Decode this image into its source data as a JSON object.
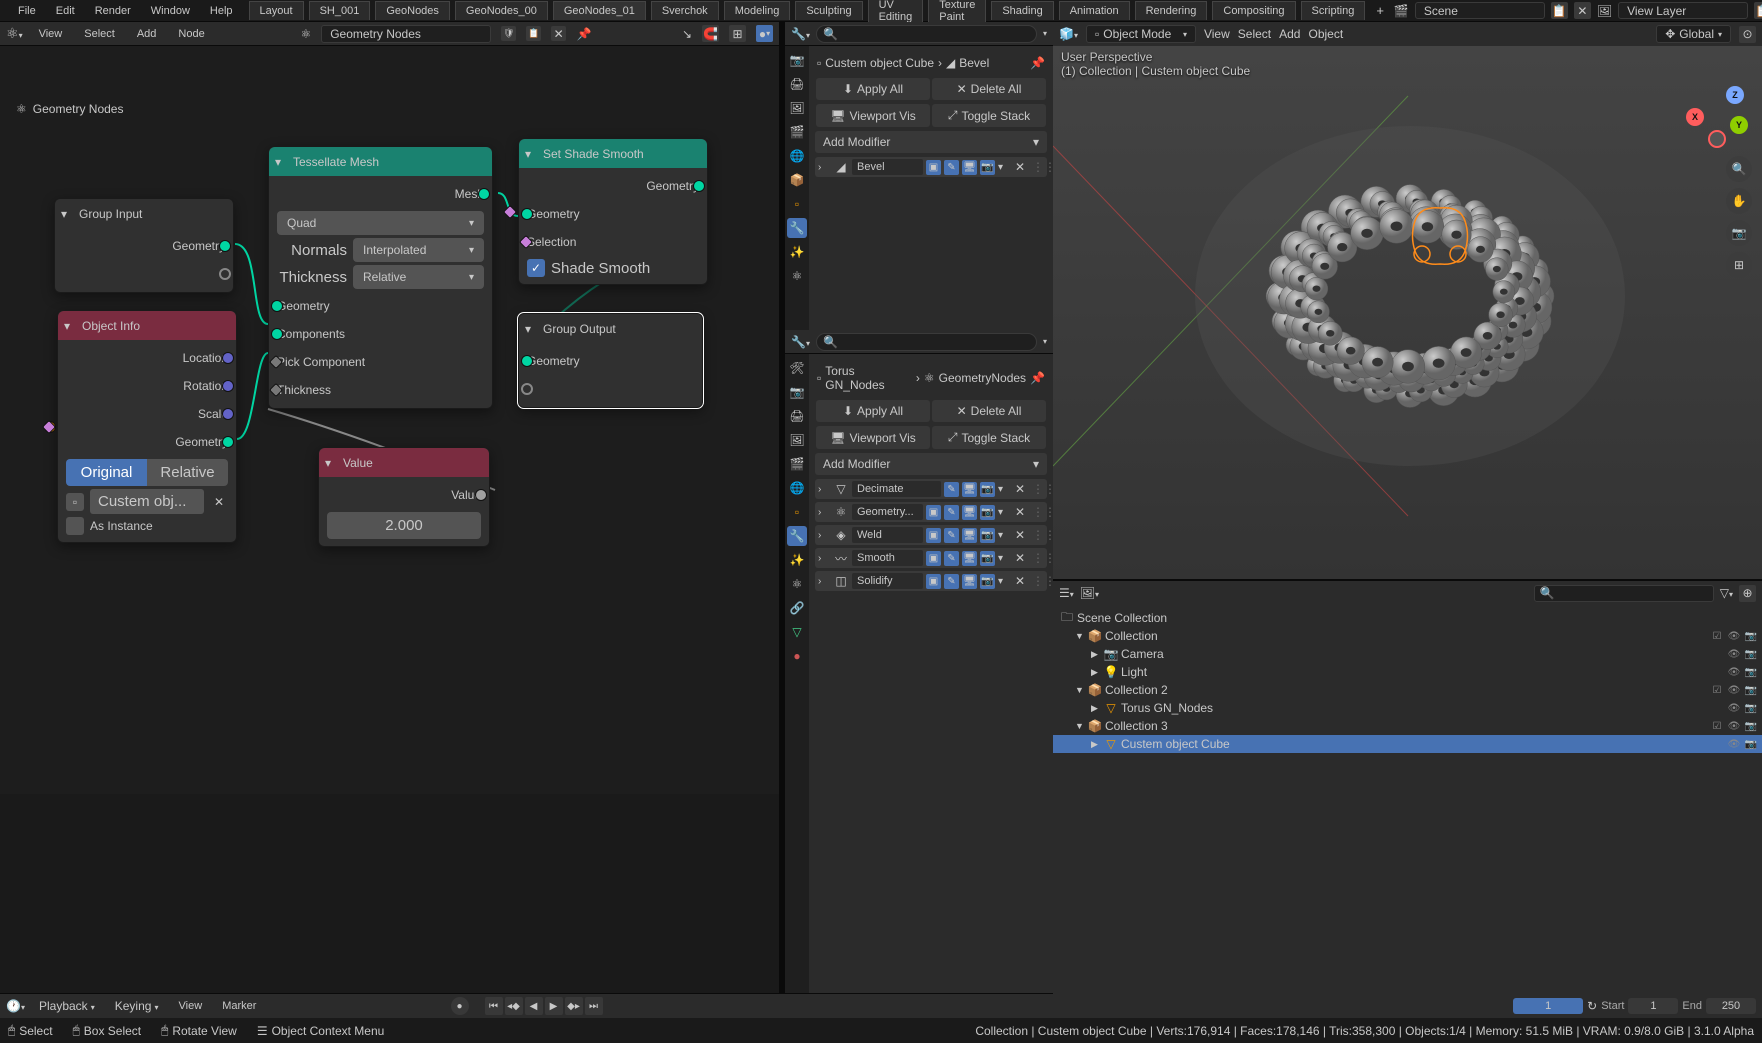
{
  "menubar": {
    "menus": [
      "File",
      "Edit",
      "Render",
      "Window",
      "Help"
    ],
    "workspaces": [
      "Layout",
      "SH_001",
      "GeoNodes",
      "GeoNodes_00",
      "GeoNodes_01",
      "Sverchok",
      "Modeling",
      "Sculpting",
      "UV Editing",
      "Texture Paint",
      "Shading",
      "Animation",
      "Rendering",
      "Compositing",
      "Scripting"
    ],
    "active_workspace": "GeoNodes_01",
    "scene_label": "Scene",
    "viewlayer_label": "View Layer"
  },
  "node_editor": {
    "header_menus": [
      "View",
      "Select",
      "Add",
      "Node"
    ],
    "datablock": "Geometry Nodes",
    "breadcrumb_icon": "node-tree",
    "breadcrumb": "Geometry Nodes"
  },
  "view3d": {
    "mode": "Object Mode",
    "menus": [
      "View",
      "Select",
      "Add",
      "Object"
    ],
    "orientation": "Global",
    "overlay_line1": "User Perspective",
    "overlay_line2": "(1) Collection | Custem object Cube"
  },
  "nodes": {
    "group_input": {
      "title": "Group Input",
      "outputs": [
        "Geometry"
      ]
    },
    "object_info": {
      "title": "Object Info",
      "outputs": [
        "Location",
        "Rotation",
        "Scale",
        "Geometry"
      ],
      "mode_options": [
        "Original",
        "Relative"
      ],
      "mode_active": "Original",
      "object_ref": "Custem obj...",
      "as_instance": "As Instance"
    },
    "tessellate": {
      "title": "Tessellate Mesh",
      "out_mesh": "Mesh",
      "mode": "Quad",
      "normals_label": "Normals",
      "normals_value": "Interpolated",
      "thickness_label": "Thickness",
      "thickness_value": "Relative",
      "in_geometry": "Geometry",
      "in_components": "Components",
      "in_pick": "Pick Component",
      "in_thickness": "Thickness"
    },
    "value": {
      "title": "Value",
      "out": "Value",
      "val": "2.000"
    },
    "shade_smooth": {
      "title": "Set Shade Smooth",
      "out_geo": "Geometry",
      "in_geo": "Geometry",
      "in_sel": "Selection",
      "shade_label": "Shade Smooth"
    },
    "group_output": {
      "title": "Group Output",
      "in_geo": "Geometry"
    }
  },
  "props1": {
    "crumb_obj": "Custem object Cube",
    "crumb_mod": "Bevel",
    "apply_all": "Apply All",
    "delete_all": "Delete All",
    "viewport_vis": "Viewport Vis",
    "toggle_stack": "Toggle Stack",
    "add_modifier": "Add Modifier",
    "modifiers": [
      {
        "name": "Bevel"
      }
    ]
  },
  "props2": {
    "crumb_obj": "Torus GN_Nodes",
    "crumb_mod": "GeometryNodes",
    "apply_all": "Apply All",
    "delete_all": "Delete All",
    "viewport_vis": "Viewport Vis",
    "toggle_stack": "Toggle Stack",
    "add_modifier": "Add Modifier",
    "modifiers": [
      {
        "name": "Decimate"
      },
      {
        "name": "Geometry..."
      },
      {
        "name": "Weld"
      },
      {
        "name": "Smooth"
      },
      {
        "name": "Solidify"
      }
    ]
  },
  "outliner": {
    "root": "Scene Collection",
    "items": [
      {
        "name": "Collection",
        "depth": 1,
        "icon": "collection",
        "exp": "▼"
      },
      {
        "name": "Camera",
        "depth": 2,
        "icon": "camera",
        "exp": "▶"
      },
      {
        "name": "Light",
        "depth": 2,
        "icon": "light",
        "exp": "▶"
      },
      {
        "name": "Collection 2",
        "depth": 1,
        "icon": "collection",
        "exp": "▼"
      },
      {
        "name": "Torus GN_Nodes",
        "depth": 2,
        "icon": "mesh",
        "exp": "▶"
      },
      {
        "name": "Collection 3",
        "depth": 1,
        "icon": "collection",
        "exp": "▼"
      },
      {
        "name": "Custem object Cube",
        "depth": 2,
        "icon": "mesh",
        "exp": "▶",
        "sel": true
      }
    ]
  },
  "timeline": {
    "menus": [
      "Playback",
      "Keying",
      "View",
      "Marker"
    ],
    "current": "1",
    "start_lbl": "Start",
    "start": "1",
    "end_lbl": "End",
    "end": "250"
  },
  "status": {
    "left": [
      {
        "icon": "mouse",
        "text": "Select"
      },
      {
        "icon": "mouse",
        "text": "Box Select"
      },
      {
        "icon": "mouse",
        "text": "Rotate View"
      },
      {
        "icon": "menu",
        "text": "Object Context Menu"
      }
    ],
    "right": "Collection | Custem object Cube | Verts:176,914 | Faces:178,146 | Tris:358,300 | Objects:1/4 | Memory: 51.5 MiB | VRAM: 0.9/8.0 GiB | 3.1.0 Alpha"
  }
}
